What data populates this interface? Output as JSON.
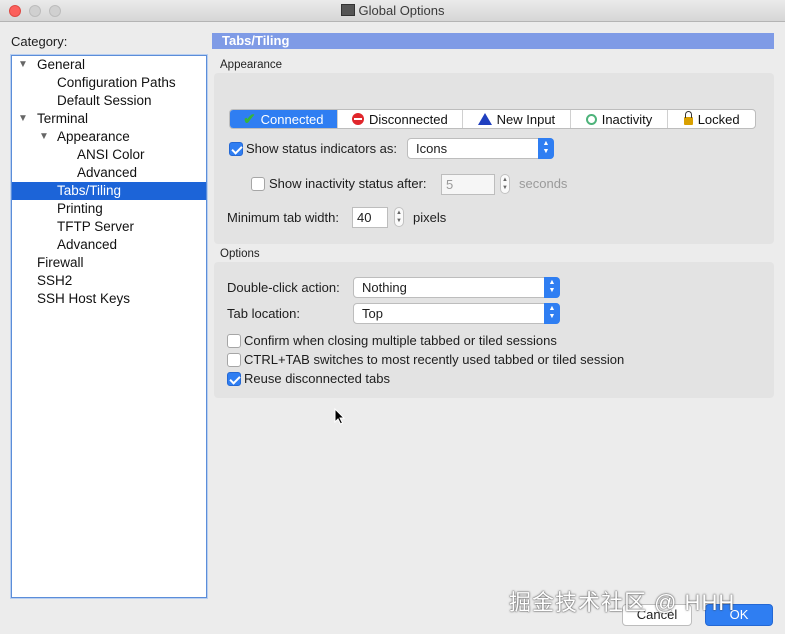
{
  "window": {
    "title": "Global Options"
  },
  "category_label": "Category:",
  "tree": [
    {
      "label": "General",
      "expanded": true
    },
    {
      "label": "Configuration Paths"
    },
    {
      "label": "Default Session"
    },
    {
      "label": "Terminal",
      "expanded": true
    },
    {
      "label": "Appearance",
      "expanded": true
    },
    {
      "label": "ANSI Color"
    },
    {
      "label": "Advanced"
    },
    {
      "label": "Tabs/Tiling",
      "selected": true
    },
    {
      "label": "Printing"
    },
    {
      "label": "TFTP Server"
    },
    {
      "label": "Advanced"
    },
    {
      "label": "Firewall"
    },
    {
      "label": "SSH2"
    },
    {
      "label": "SSH Host Keys"
    }
  ],
  "panel": {
    "title": "Tabs/Tiling",
    "appearance": {
      "section_label": "Appearance",
      "status_segments": [
        {
          "label": "Connected",
          "icon": "checkmark-icon",
          "active": true
        },
        {
          "label": "Disconnected",
          "icon": "stop-icon"
        },
        {
          "label": "New Input",
          "icon": "warning-icon"
        },
        {
          "label": "Inactivity",
          "icon": "clock-icon"
        },
        {
          "label": "Locked",
          "icon": "lock-icon"
        }
      ],
      "show_status_label": "Show status indicators as:",
      "show_status_checked": true,
      "show_status_value": "Icons",
      "show_inactivity_label": "Show inactivity status after:",
      "show_inactivity_checked": false,
      "inactivity_value": "5",
      "inactivity_unit": "seconds",
      "min_tab_width_label": "Minimum tab width:",
      "min_tab_width_value": "40",
      "min_tab_width_unit": "pixels"
    },
    "options": {
      "section_label": "Options",
      "double_click_label": "Double-click action:",
      "double_click_value": "Nothing",
      "tab_location_label": "Tab location:",
      "tab_location_value": "Top",
      "checkboxes": [
        {
          "label": "Confirm when closing multiple tabbed or tiled sessions",
          "checked": false
        },
        {
          "label": "CTRL+TAB switches to most recently used tabbed or tiled session",
          "checked": false
        },
        {
          "label": "Reuse disconnected tabs",
          "checked": true
        }
      ]
    }
  },
  "buttons": {
    "cancel": "Cancel",
    "ok": "OK"
  },
  "watermark": "掘金技术社区 @ HHH",
  "colors": {
    "accent": "#2f7ef2",
    "selection": "#1c64d8",
    "panel_header": "#7f9be6"
  }
}
